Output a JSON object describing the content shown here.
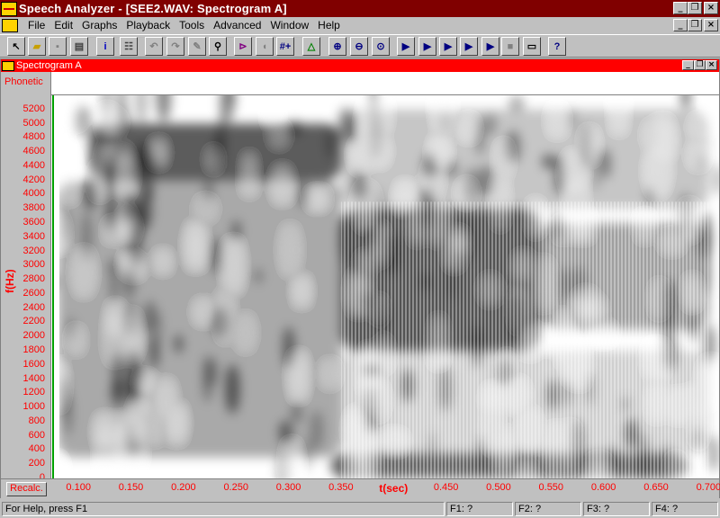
{
  "window": {
    "title": "Speech Analyzer - [SEE2.WAV: Spectrogram A]",
    "controls": {
      "minimize": "_",
      "restore": "❐",
      "close": "×"
    }
  },
  "menu": [
    "File",
    "Edit",
    "Graphs",
    "Playback",
    "Tools",
    "Advanced",
    "Window",
    "Help"
  ],
  "toolbar": [
    {
      "name": "select-icon",
      "glyph": "↖",
      "color": "#000"
    },
    {
      "name": "open-folder-icon",
      "glyph": "▰",
      "color": "#c8a000"
    },
    {
      "name": "save-icon",
      "glyph": "▪",
      "color": "#808080"
    },
    {
      "name": "print-icon",
      "glyph": "▤",
      "color": "#404040"
    },
    {
      "name": "info-icon",
      "glyph": "i",
      "color": "#0000c0"
    },
    {
      "name": "layout-icon",
      "glyph": "☷",
      "color": "#404040"
    },
    {
      "name": "undo-icon",
      "glyph": "↶",
      "color": "#808080"
    },
    {
      "name": "redo-icon",
      "glyph": "↷",
      "color": "#808080"
    },
    {
      "name": "edit-icon",
      "glyph": "✎",
      "color": "#808080"
    },
    {
      "name": "find-icon",
      "glyph": "⚲",
      "color": "#000"
    },
    {
      "name": "marker-icon",
      "glyph": "⊳",
      "color": "#800080"
    },
    {
      "name": "segment-icon",
      "glyph": "◖",
      "color": "#808080"
    },
    {
      "name": "add-marker-icon",
      "glyph": "#+",
      "color": "#000080"
    },
    {
      "name": "graph-icon",
      "glyph": "△",
      "color": "#008000"
    },
    {
      "name": "zoom-in-icon",
      "glyph": "⊕",
      "color": "#000080"
    },
    {
      "name": "zoom-out-icon",
      "glyph": "⊖",
      "color": "#000080"
    },
    {
      "name": "zoom-all-icon",
      "glyph": "⊙",
      "color": "#000080"
    },
    {
      "name": "play-icon",
      "glyph": "▶",
      "color": "#000080"
    },
    {
      "name": "play-segment-icon",
      "glyph": "▶",
      "color": "#000080"
    },
    {
      "name": "play-between-icon",
      "glyph": "▶",
      "color": "#000080"
    },
    {
      "name": "play-cursor-icon",
      "glyph": "▶",
      "color": "#000080"
    },
    {
      "name": "play-all-icon",
      "glyph": "▶",
      "color": "#000080"
    },
    {
      "name": "stop-icon",
      "glyph": "■",
      "color": "#808080"
    },
    {
      "name": "player-icon",
      "glyph": "▭",
      "color": "#000"
    },
    {
      "name": "help-icon",
      "glyph": "?",
      "color": "#000080"
    }
  ],
  "graph": {
    "title": "Spectrogram A",
    "phonetic_label": "Phonetic",
    "recalc_label": "Recalc."
  },
  "chart_data": {
    "type": "heatmap",
    "title": "Spectrogram A",
    "xlabel": "t(sec)",
    "ylabel": "f(Hz)",
    "xlim": [
      0.075,
      0.71
    ],
    "ylim": [
      0,
      5400
    ],
    "x_ticks": [
      "0.100",
      "0.150",
      "0.200",
      "0.250",
      "0.300",
      "0.350",
      "0.450",
      "0.500",
      "0.550",
      "0.600",
      "0.650",
      "0.700"
    ],
    "y_ticks": [
      "0",
      "200",
      "400",
      "600",
      "800",
      "1000",
      "1200",
      "1400",
      "1600",
      "1800",
      "2000",
      "2200",
      "2400",
      "2600",
      "2800",
      "3000",
      "3200",
      "3400",
      "3600",
      "3800",
      "4000",
      "4200",
      "4400",
      "4600",
      "4800",
      "5000",
      "5200"
    ],
    "colormap": "grayscale",
    "regions": [
      {
        "t": [
          0.11,
          0.35
        ],
        "f": [
          4200,
          5000
        ],
        "intensity": 0.85
      },
      {
        "t": [
          0.08,
          0.35
        ],
        "f": [
          300,
          4200
        ],
        "intensity": 0.45
      },
      {
        "t": [
          0.35,
          0.54
        ],
        "f": [
          1800,
          3800
        ],
        "intensity": 0.9
      },
      {
        "t": [
          0.34,
          0.68
        ],
        "f": [
          0,
          350
        ],
        "intensity": 0.8
      },
      {
        "t": [
          0.54,
          0.7
        ],
        "f": [
          2100,
          3600
        ],
        "intensity": 0.5
      },
      {
        "t": [
          0.35,
          0.7
        ],
        "f": [
          350,
          1800
        ],
        "intensity": 0.25
      },
      {
        "t": [
          0.35,
          0.7
        ],
        "f": [
          3800,
          5200
        ],
        "intensity": 0.3
      }
    ]
  },
  "status": {
    "help": "For Help, press F1",
    "f1": "F1: ?",
    "f2": "F2: ?",
    "f3": "F3: ?",
    "f4": "F4: ?"
  }
}
